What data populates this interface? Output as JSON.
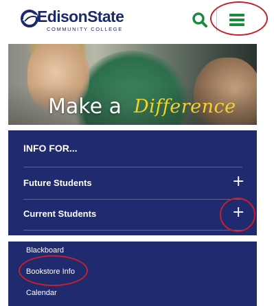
{
  "header": {
    "logo_name": "EdisonState",
    "logo_subtitle": "COMMUNITY COLLEGE",
    "search_icon": "search-icon",
    "menu_icon": "hamburger-menu-icon"
  },
  "hero": {
    "title": "Make a",
    "script_word": "Difference"
  },
  "info_for": {
    "heading": "INFO FOR...",
    "items": [
      {
        "label": "Future Students",
        "toggle": "+"
      },
      {
        "label": "Current Students",
        "toggle": "+"
      }
    ]
  },
  "current_students_links": [
    "Blackboard",
    "Bookstore Info",
    "Calendar"
  ],
  "colors": {
    "brand_navy": "#1f2b6e",
    "brand_green": "#1b8a3c",
    "accent_yellow": "#f4d22a",
    "annotation_red": "#c8202a"
  }
}
